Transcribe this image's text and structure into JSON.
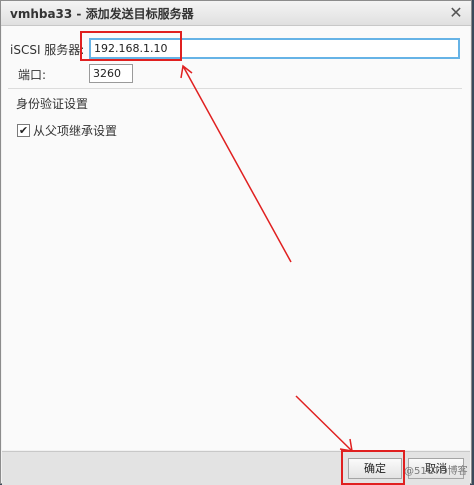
{
  "dialog": {
    "title": "vmhba33 - 添加发送目标服务器",
    "close_symbol": "✕"
  },
  "form": {
    "server_label": "iSCSI 服务器:",
    "server_value": "192.168.1.10",
    "port_label": "端口:",
    "port_value": "3260",
    "auth_section_title": "身份验证设置",
    "inherit_checkbox_label": "从父项继承设置",
    "inherit_checked": true,
    "check_symbol": "✔"
  },
  "buttons": {
    "ok_label": "确定",
    "cancel_label": "取消"
  },
  "watermark": "@51CTO博客",
  "colors": {
    "annotation_red": "#e02020",
    "input_focus_border": "#66b3e6"
  }
}
